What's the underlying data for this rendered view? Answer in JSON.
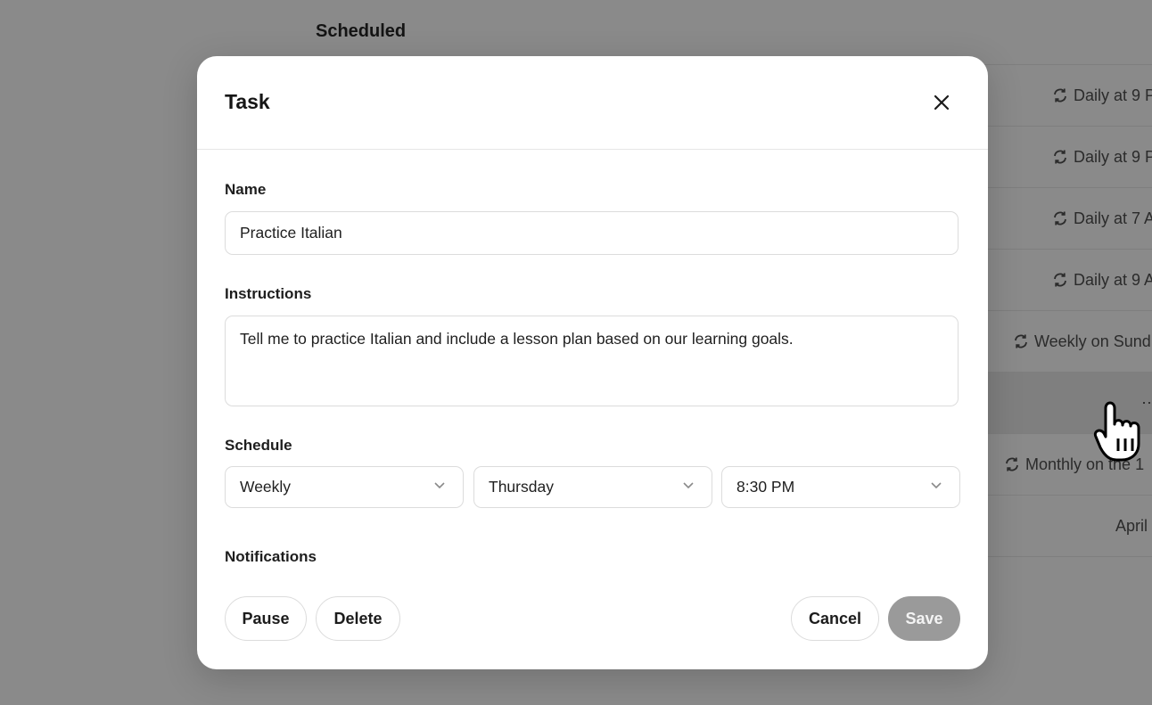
{
  "background": {
    "section_title": "Scheduled",
    "rows": [
      {
        "icon": "repeat-icon",
        "text": "Daily at 9 P"
      },
      {
        "icon": "repeat-icon",
        "text": "Daily at 9 P"
      },
      {
        "icon": "repeat-icon",
        "text": "Daily at 7 A"
      },
      {
        "icon": "repeat-icon",
        "text": "Daily at 9 A"
      },
      {
        "icon": "repeat-icon",
        "text": "Weekly on Sund"
      },
      {
        "icon": "more-icon",
        "text": ""
      },
      {
        "icon": "repeat-icon",
        "text": "Monthly on the 1"
      },
      {
        "icon": "",
        "text": "April"
      }
    ]
  },
  "modal": {
    "title": "Task",
    "close_icon": "close-icon",
    "name": {
      "label": "Name",
      "value": "Practice Italian"
    },
    "instructions": {
      "label": "Instructions",
      "value": "Tell me to practice Italian and include a lesson plan based on our learning goals."
    },
    "schedule": {
      "label": "Schedule",
      "frequency": "Weekly",
      "day": "Thursday",
      "time": "8:30 PM"
    },
    "notifications": {
      "label": "Notifications"
    },
    "buttons": {
      "pause": "Pause",
      "delete": "Delete",
      "cancel": "Cancel",
      "save": "Save"
    }
  },
  "colors": {
    "overlay": "#8a8a8a",
    "modal_bg": "#ffffff",
    "save_disabled": "#9a9a9a",
    "border": "#dcdcdc"
  }
}
